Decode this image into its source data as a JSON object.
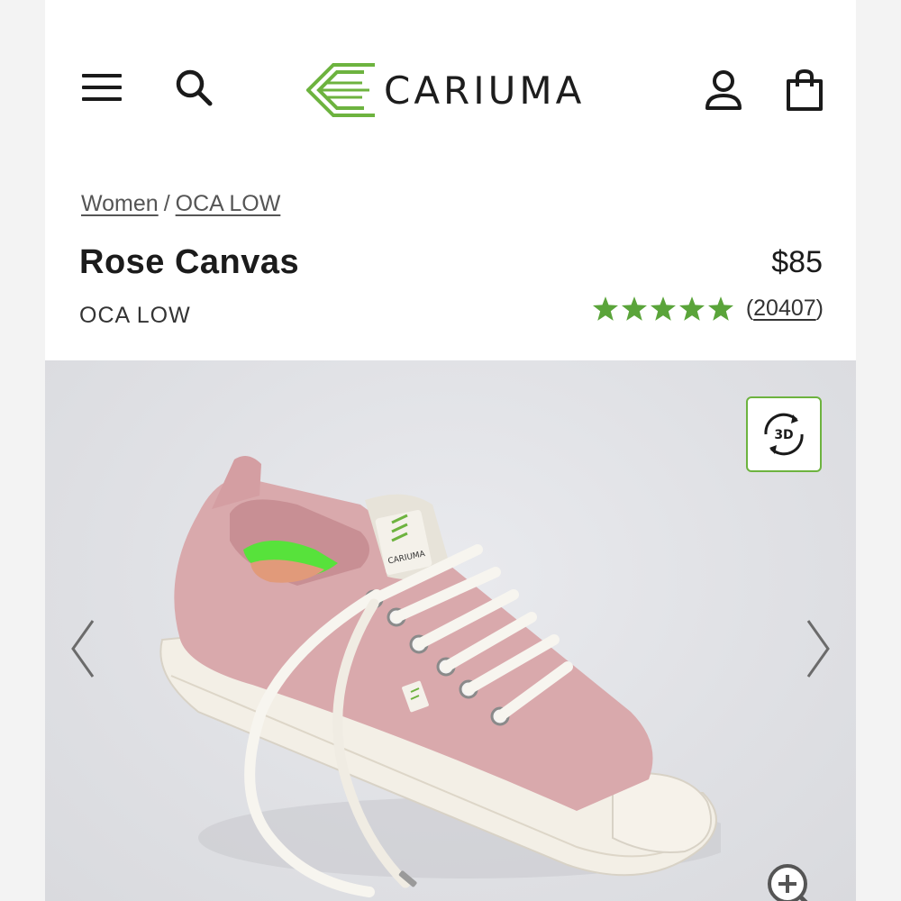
{
  "header": {
    "brand": "CARIUMA",
    "menu_icon": "hamburger-menu-icon",
    "search_icon": "search-icon",
    "account_icon": "user-icon",
    "bag_icon": "shopping-bag-icon"
  },
  "breadcrumb": {
    "items": [
      "Women",
      "OCA LOW"
    ],
    "separator": "/"
  },
  "product": {
    "name": "Rose Canvas",
    "price": "$85",
    "line": "OCA LOW",
    "rating": 5,
    "review_count": "20407",
    "review_open": "(",
    "review_close": ")"
  },
  "gallery": {
    "badge_3d": "3D",
    "prev_icon": "chevron-left-icon",
    "next_icon": "chevron-right-icon",
    "zoom_icon": "zoom-in-icon",
    "tongue_label": "CARIUMA"
  },
  "colors": {
    "brand_green": "#6db33f",
    "star_green": "#5aa43a",
    "shoe_pink": "#d9a9ac",
    "sole_cream": "#f3efe6"
  }
}
